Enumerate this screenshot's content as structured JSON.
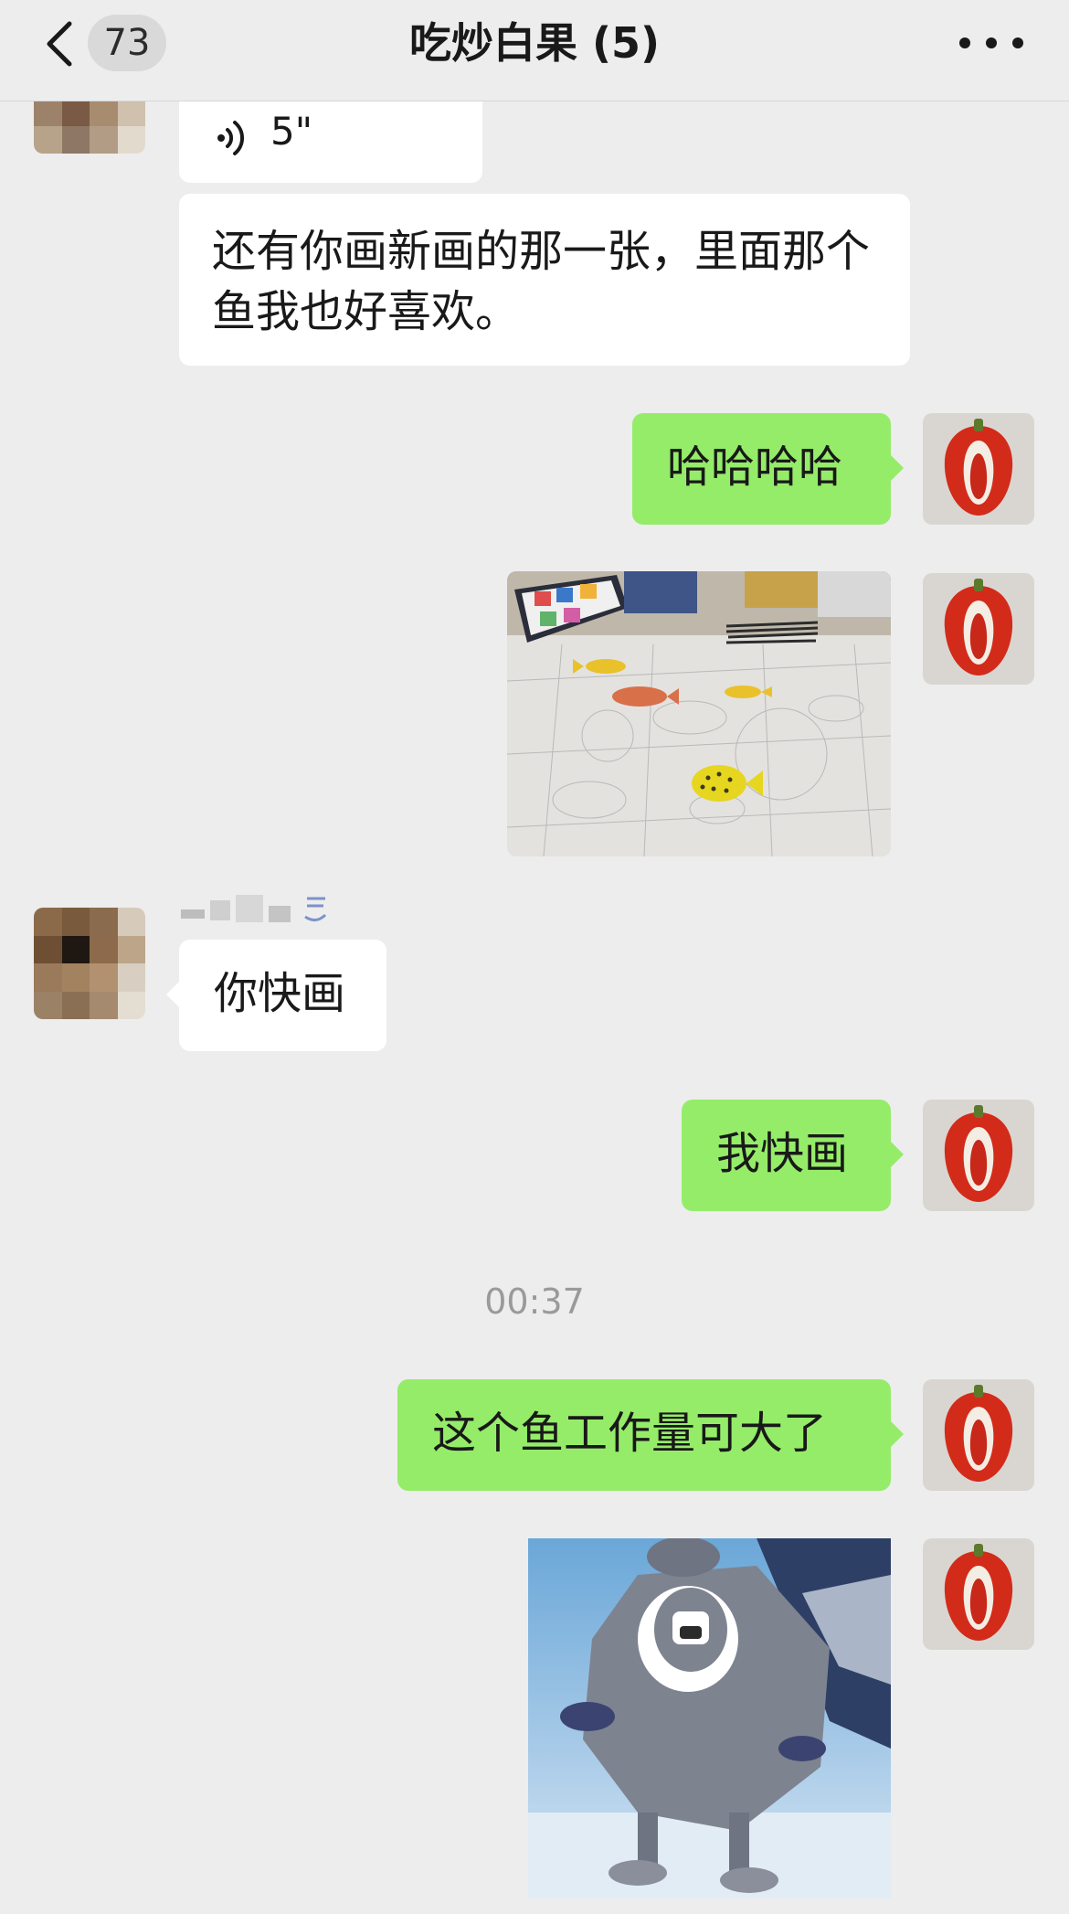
{
  "header": {
    "back_icon": "chevron-left-icon",
    "unread_count": "73",
    "title": "吃炒白果 (5)",
    "more_icon": "more-dots-icon"
  },
  "messages": [
    {
      "side": "left",
      "type": "voice",
      "duration": "5\"",
      "icon": "voice-wave-icon"
    },
    {
      "side": "left",
      "type": "text",
      "text": "还有你画新画的那一张，里面那个鱼我也好喜欢。"
    },
    {
      "side": "right",
      "type": "text",
      "text": "哈哈哈哈"
    },
    {
      "side": "right",
      "type": "image",
      "description_icon": "drawing-photo"
    },
    {
      "side": "left",
      "type": "text",
      "sender_name_hidden": true,
      "text": "你快画"
    },
    {
      "side": "right",
      "type": "text",
      "text": "我快画"
    },
    {
      "type": "timestamp",
      "text": "00:37"
    },
    {
      "side": "right",
      "type": "text",
      "text": "这个鱼工作量可大了"
    },
    {
      "side": "right",
      "type": "image",
      "description_icon": "sticker-image"
    }
  ],
  "colors": {
    "background": "#ededed",
    "bubble_self": "#95ec69",
    "bubble_other": "#ffffff",
    "timestamp_text": "#9a9a9a"
  }
}
